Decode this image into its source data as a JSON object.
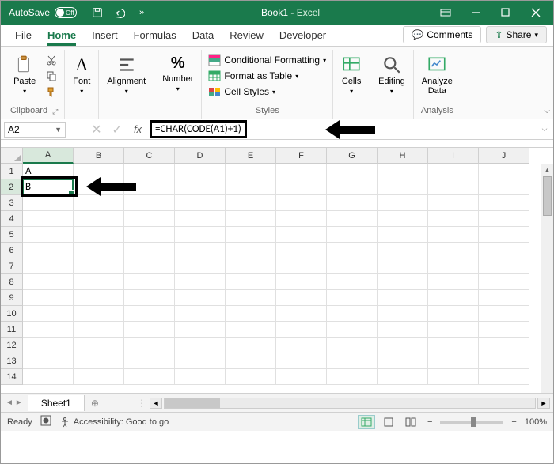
{
  "titlebar": {
    "autosave_label": "AutoSave",
    "autosave_state": "Off",
    "document": "Book1",
    "app": "Excel"
  },
  "tabs": {
    "file": "File",
    "home": "Home",
    "insert": "Insert",
    "formulas": "Formulas",
    "data": "Data",
    "review": "Review",
    "developer": "Developer",
    "comments": "Comments",
    "share": "Share"
  },
  "ribbon": {
    "clipboard": {
      "paste": "Paste",
      "label": "Clipboard"
    },
    "font": {
      "btn": "Font"
    },
    "alignment": {
      "btn": "Alignment"
    },
    "number": {
      "btn": "Number"
    },
    "styles": {
      "cond_fmt": "Conditional Formatting",
      "fmt_table": "Format as Table",
      "cell_styles": "Cell Styles",
      "label": "Styles"
    },
    "cells": {
      "btn": "Cells"
    },
    "editing": {
      "btn": "Editing"
    },
    "analysis": {
      "btn": "Analyze Data",
      "label": "Analysis"
    }
  },
  "formula_bar": {
    "name_box": "A2",
    "formula": "=CHAR(CODE(A1)+1)"
  },
  "grid": {
    "columns": [
      "A",
      "B",
      "C",
      "D",
      "E",
      "F",
      "G",
      "H",
      "I",
      "J"
    ],
    "rows": [
      "1",
      "2",
      "3",
      "4",
      "5",
      "6",
      "7",
      "8",
      "9",
      "10",
      "11",
      "12",
      "13",
      "14"
    ],
    "active_col": 0,
    "active_row": 1,
    "cells": {
      "A1": "A",
      "A2": "B"
    }
  },
  "sheet_tabs": {
    "sheet1": "Sheet1"
  },
  "statusbar": {
    "ready": "Ready",
    "accessibility": "Accessibility: Good to go",
    "zoom": "100%"
  }
}
